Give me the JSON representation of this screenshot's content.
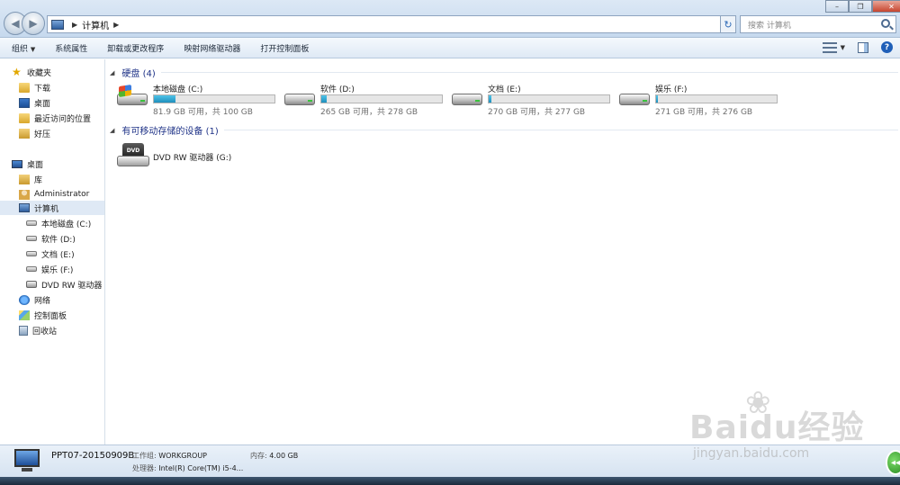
{
  "address": {
    "crumb": "计算机"
  },
  "search": {
    "placeholder": "搜索 计算机"
  },
  "toolbar": {
    "items": [
      "组织",
      "系统属性",
      "卸载或更改程序",
      "映射网络驱动器",
      "打开控制面板"
    ]
  },
  "navpane": {
    "favorites": {
      "label": "收藏夹",
      "items": [
        "下载",
        "桌面",
        "最近访问的位置",
        "好压"
      ]
    },
    "desktop": {
      "label": "桌面",
      "items": [
        "库",
        "Administrator",
        "计算机"
      ],
      "drives": [
        "本地磁盘 (C:)",
        "软件 (D:)",
        "文档 (E:)",
        "娱乐 (F:)",
        "DVD RW 驱动器 ("
      ],
      "more": [
        "网络",
        "控制面板",
        "回收站"
      ]
    }
  },
  "groups": {
    "hard_disks": {
      "title": "硬盘 (4)"
    },
    "removable": {
      "title": "有可移动存储的设备 (1)"
    }
  },
  "drives": [
    {
      "name": "本地磁盘 (C:)",
      "free": "81.9 GB 可用，共 100 GB",
      "used_fraction": 0.181
    },
    {
      "name": "软件 (D:)",
      "free": "265 GB 可用，共 278 GB",
      "used_fraction": 0.047
    },
    {
      "name": "文档 (E:)",
      "free": "270 GB 可用，共 277 GB",
      "used_fraction": 0.025
    },
    {
      "name": "娱乐 (F:)",
      "free": "271 GB 可用，共 276 GB",
      "used_fraction": 0.018
    }
  ],
  "dvd": {
    "name": "DVD RW 驱动器 (G:)",
    "label": "DVD"
  },
  "details": {
    "computer_name": "PPT07-20150909B",
    "workgroup_label": "工作组:",
    "workgroup": "WORKGROUP",
    "memory_label": "内存:",
    "memory": "4.00 GB",
    "cpu_label": "处理器:",
    "cpu": "Intel(R) Core(TM) i5-4..."
  },
  "watermark": {
    "brand": "Baidu经验",
    "url": "jingyan.baidu.com"
  },
  "colors": {
    "accent": "#1e3287",
    "bar_fill": "#26a0da"
  }
}
